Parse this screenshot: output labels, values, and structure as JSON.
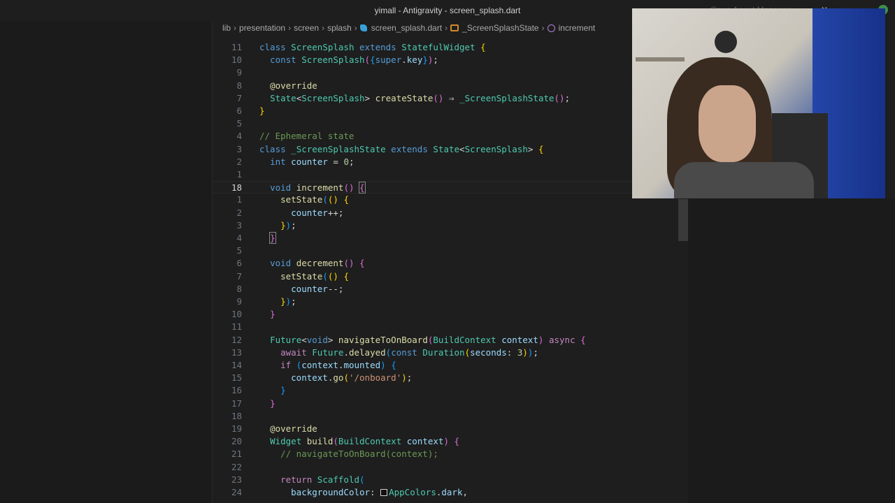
{
  "window": {
    "title": "yimall - Antigravity - screen_splash.dart",
    "right_label": "Open Agent Manager"
  },
  "breadcrumb": [
    "lib",
    "presentation",
    "screen",
    "splash",
    "screen_splash.dart",
    "_ScreenSplashState",
    "increment"
  ],
  "editor": {
    "lines": [
      {
        "n": "11",
        "html": "<span class='kw2'>class</span> <span class='ty'>ScreenSplash</span> <span class='kw2'>extends</span> <span class='ty'>StatefulWidget</span> <span class='b1'>{</span>"
      },
      {
        "n": "10",
        "html": "  <span class='kw2'>const</span> <span class='ty'>ScreenSplash</span><span class='b2'>(</span><span class='b3'>{</span><span class='kw2'>super</span>.<span class='va'>key</span><span class='b3'>}</span><span class='b2'>)</span>;"
      },
      {
        "n": "9",
        "html": ""
      },
      {
        "n": "8",
        "html": "  <span class='an'>@override</span>"
      },
      {
        "n": "7",
        "html": "  <span class='ty'>State</span>&lt;<span class='ty'>ScreenSplash</span>&gt; <span class='fn'>createState</span><span class='b2'>()</span> <span class='op'>⇒</span> <span class='ty'>_ScreenSplashState</span><span class='b2'>()</span>;"
      },
      {
        "n": "6",
        "html": "<span class='b1'>}</span>"
      },
      {
        "n": "5",
        "html": ""
      },
      {
        "n": "4",
        "html": "<span class='cm'>// Ephemeral state</span>"
      },
      {
        "n": "3",
        "html": "<span class='kw2'>class</span> <span class='ty'>_ScreenSplashState</span> <span class='kw2'>extends</span> <span class='ty'>State</span>&lt;<span class='ty'>ScreenSplash</span>&gt; <span class='b1'>{</span>"
      },
      {
        "n": "2",
        "html": "  <span class='kw2'>int</span> <span class='va'>counter</span> = <span class='nu'>0</span>;"
      },
      {
        "n": "1",
        "html": ""
      },
      {
        "n": "18",
        "html": "  <span class='kw2'>void</span> <span class='fn'>increment</span><span class='b2'>()</span> <span class='b2 hl'>{</span>",
        "current": true
      },
      {
        "n": "1",
        "html": "    <span class='fn'>setState</span><span class='b3'>(</span><span class='b1'>()</span> <span class='b1'>{</span>"
      },
      {
        "n": "2",
        "html": "      <span class='va'>counter</span>++;"
      },
      {
        "n": "3",
        "html": "    <span class='b1'>}</span><span class='b3'>)</span>;"
      },
      {
        "n": "4",
        "html": "  <span class='b2 hl'>}</span>"
      },
      {
        "n": "5",
        "html": ""
      },
      {
        "n": "6",
        "html": "  <span class='kw2'>void</span> <span class='fn'>decrement</span><span class='b2'>()</span> <span class='b2'>{</span>"
      },
      {
        "n": "7",
        "html": "    <span class='fn'>setState</span><span class='b3'>(</span><span class='b1'>()</span> <span class='b1'>{</span>"
      },
      {
        "n": "8",
        "html": "      <span class='va'>counter</span>--;"
      },
      {
        "n": "9",
        "html": "    <span class='b1'>}</span><span class='b3'>)</span>;"
      },
      {
        "n": "10",
        "html": "  <span class='b2'>}</span>"
      },
      {
        "n": "11",
        "html": ""
      },
      {
        "n": "12",
        "html": "  <span class='ty'>Future</span>&lt;<span class='kw2'>void</span>&gt; <span class='fn'>navigateToOnBoard</span><span class='b2'>(</span><span class='ty'>BuildContext</span> <span class='va'>context</span><span class='b2'>)</span> <span class='kw'>async</span> <span class='b2'>{</span>"
      },
      {
        "n": "13",
        "html": "    <span class='kw'>await</span> <span class='ty'>Future</span>.<span class='fn'>delayed</span><span class='b3'>(</span><span class='kw2'>const</span> <span class='ty'>Duration</span><span class='b1'>(</span><span class='va'>seconds</span>: <span class='nu'>3</span><span class='b1'>)</span><span class='b3'>)</span>;"
      },
      {
        "n": "14",
        "html": "    <span class='kw'>if</span> <span class='b3'>(</span><span class='va'>context</span>.<span class='va'>mounted</span><span class='b3'>)</span> <span class='b3'>{</span>"
      },
      {
        "n": "15",
        "html": "      <span class='va'>context</span>.<span class='fn'>go</span><span class='b1'>(</span><span class='st'>'/onboard'</span><span class='b1'>)</span>;"
      },
      {
        "n": "16",
        "html": "    <span class='b3'>}</span>"
      },
      {
        "n": "17",
        "html": "  <span class='b2'>}</span>"
      },
      {
        "n": "18",
        "html": ""
      },
      {
        "n": "19",
        "html": "  <span class='an'>@override</span>"
      },
      {
        "n": "20",
        "html": "  <span class='ty'>Widget</span> <span class='fn'>build</span><span class='b2'>(</span><span class='ty'>BuildContext</span> <span class='va'>context</span><span class='b2'>)</span> <span class='b2'>{</span>"
      },
      {
        "n": "21",
        "html": "    <span class='cm'>// navigateToOnBoard(context);</span>"
      },
      {
        "n": "22",
        "html": ""
      },
      {
        "n": "23",
        "html": "    <span class='kw'>return</span> <span class='ty'>Scaffold</span><span class='b3'>(</span>"
      },
      {
        "n": "24",
        "html": "      <span class='va'>backgroundColor</span>: <span class='color-swatch'></span><span class='ty'>AppColors</span>.<span class='va'>dark</span>,"
      }
    ]
  }
}
